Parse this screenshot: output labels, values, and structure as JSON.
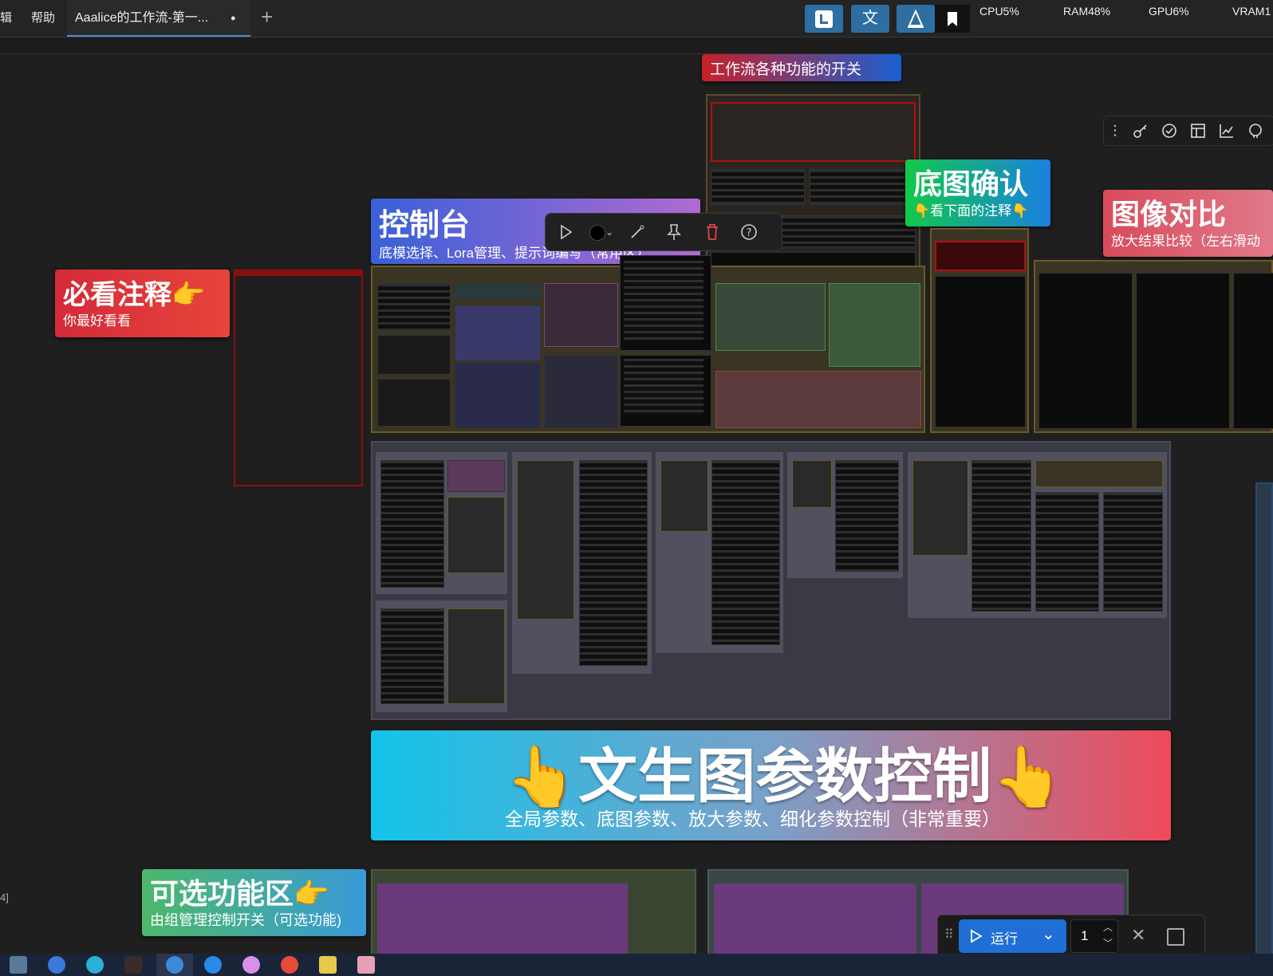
{
  "menu": {
    "edit_partial": "辑",
    "help": "帮助"
  },
  "tabs": {
    "active_tab_title": "Aaalice的工作流-第一...",
    "modified_dot": "●",
    "new_tab": "+"
  },
  "toolbar_icons": [
    "l-logo-icon",
    "translate-icon",
    "sail-icon",
    "bookmark-icon"
  ],
  "stats": {
    "cpu": "CPU5%",
    "ram": "RAM48%",
    "gpu": "GPU6%",
    "vram": "VRAM1"
  },
  "labels": {
    "top_switch": "工作流各种功能的开关",
    "console_title": "控制台",
    "console_subtitle": "底模选择、Lora管理、提示词编写（常用区）",
    "must_read_title": "必看注释👉",
    "must_read_subtitle": "你最好看看",
    "base_confirm_title": "底图确认",
    "base_confirm_subtitle": "👇看下面的注释👇",
    "compare_title": "图像对比",
    "compare_subtitle": "放大结果比较（左右滑动",
    "t2i_title": "👆文生图参数控制👆",
    "t2i_subtitle": "全局参数、底图参数、放大参数、细化参数控制（非常重要）",
    "optional_title": "可选功能区👉",
    "optional_subtitle": "由组管理控制开关（可选功能)"
  },
  "node_toolbar": [
    "play-icon",
    "color-dot-icon",
    "chevron-down-icon",
    "wand-icon",
    "pin-icon",
    "trash-icon",
    "help-icon"
  ],
  "right_iconbar": [
    "more-vertical-icon",
    "key-icon",
    "check-circle-icon",
    "layout-icon",
    "chart-icon",
    "github-icon"
  ],
  "run": {
    "label": "运行",
    "batch_count": "1"
  },
  "side_text": "4]",
  "colors": {
    "accent": "#2e6ea0",
    "run_blue": "#1f6fd6",
    "group_red": "#a01010",
    "group_olive": "#6a5a2a"
  }
}
